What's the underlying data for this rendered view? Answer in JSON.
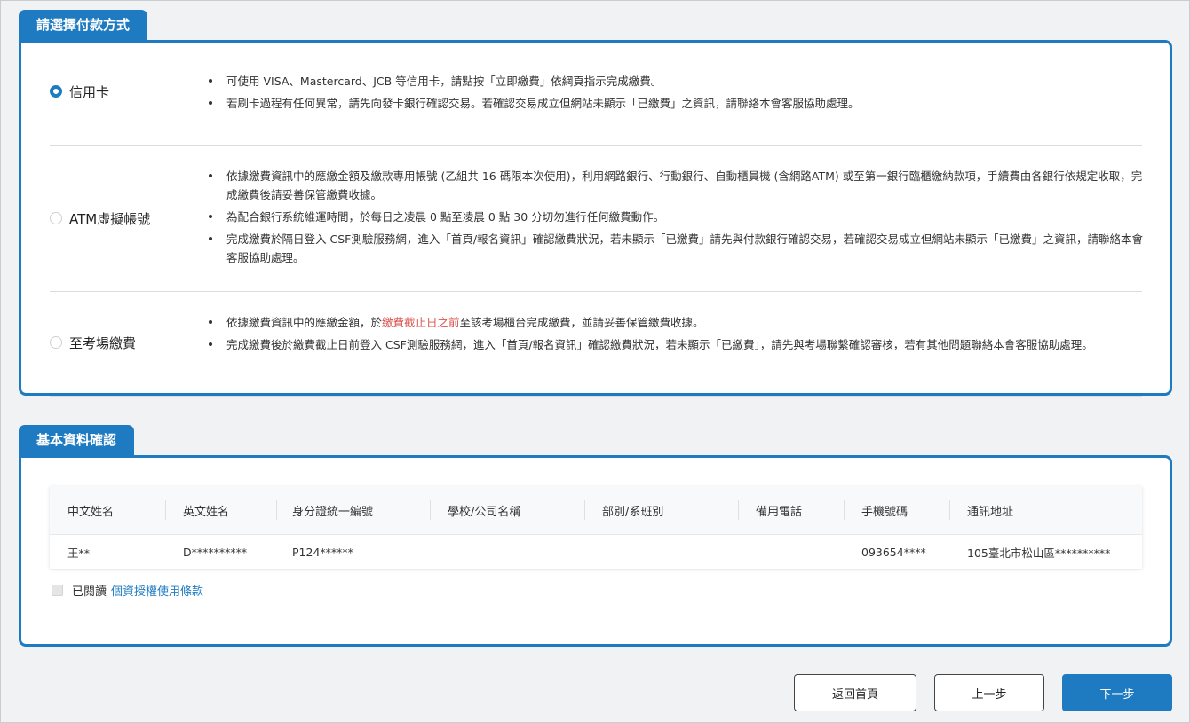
{
  "payment": {
    "title": "請選擇付款方式",
    "options": [
      {
        "label": "信用卡",
        "checked": true,
        "lines": [
          "可使用 VISA、Mastercard、JCB 等信用卡，請點按「立即繳費」依網頁指示完成繳費。",
          "若刷卡過程有任何異常，請先向發卡銀行確認交易。若確認交易成立但網站未顯示「已繳費」之資訊，請聯絡本會客服協助處理。"
        ]
      },
      {
        "label": "ATM虛擬帳號",
        "checked": false,
        "lines": [
          "依據繳費資訊中的應繳金額及繳款專用帳號 (乙組共 16 碼限本次使用)，利用網路銀行、行動銀行、自動櫃員機 (含網路ATM) 或至第一銀行臨櫃繳納款項，手續費由各銀行依規定收取，完成繳費後請妥善保管繳費收據。",
          "為配合銀行系統維運時間，於每日之凌晨 0 點至凌晨 0 點 30 分切勿進行任何繳費動作。",
          "完成繳費於隔日登入 CSF測驗服務網，進入「首頁/報名資訊」確認繳費狀況，若未顯示「已繳費」請先與付款銀行確認交易，若確認交易成立但網站未顯示「已繳費」之資訊，請聯絡本會客服協助處理。"
        ]
      },
      {
        "label": "至考場繳費",
        "checked": false,
        "line1_before": "依據繳費資訊中的應繳金額，於",
        "line1_highlight": "繳費截止日之前",
        "line1_after": "至該考場櫃台完成繳費，並請妥善保管繳費收據。",
        "line2": "完成繳費後於繳費截止日前登入 CSF測驗服務網，進入「首頁/報名資訊」確認繳費狀況，若未顯示「已繳費」，請先與考場聯繫確認審核，若有其他問題聯絡本會客服協助處理。",
        "highlight_color": "#d9534f"
      }
    ]
  },
  "basic": {
    "title": "基本資料確認",
    "columns": [
      "中文姓名",
      "英文姓名",
      "身分證統一編號",
      "學校/公司名稱",
      "部別/系班別",
      "備用電話",
      "手機號碼",
      "通訊地址"
    ],
    "row": [
      "王**",
      "D**********",
      "P124******",
      "",
      "",
      "",
      "093654****",
      "105臺北市松山區**********"
    ],
    "agree_text": "已閱讀",
    "agree_link": "個資授權使用條款"
  },
  "buttons": {
    "home": "返回首頁",
    "prev": "上一步",
    "next": "下一步"
  },
  "colors": {
    "accent": "#1f7bc1",
    "highlight": "#d9534f",
    "background": "#f1f2f4"
  }
}
